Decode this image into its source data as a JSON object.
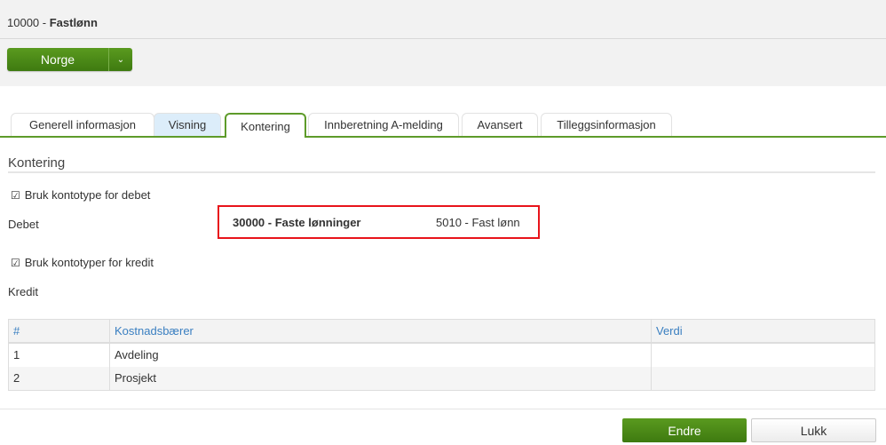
{
  "header": {
    "code": "10000",
    "separator": " - ",
    "name": "Fastlønn"
  },
  "country_button": {
    "label": "Norge",
    "dropdown_icon": "chevron-down-icon"
  },
  "tabs": [
    {
      "label": "Generell informasjon"
    },
    {
      "label": "Visning"
    },
    {
      "label": "Kontering"
    },
    {
      "label": "Innberetning A-melding"
    },
    {
      "label": "Avansert"
    },
    {
      "label": "Tilleggsinformasjon"
    }
  ],
  "section": {
    "title": "Kontering"
  },
  "debet": {
    "checkbox_label": "Bruk kontotype for debet",
    "label": "Debet",
    "account_type": "30000 - Faste lønninger",
    "account": "5010 - Fast lønn"
  },
  "kredit": {
    "checkbox_label": "Bruk kontotyper for kredit",
    "label": "Kredit"
  },
  "table": {
    "headers": [
      "#",
      "Kostnadsbærer",
      "Verdi"
    ],
    "rows": [
      [
        "1",
        "Avdeling",
        ""
      ],
      [
        "2",
        "Prosjekt",
        ""
      ]
    ]
  },
  "footer": {
    "edit_label": "Endre",
    "close_label": "Lukk"
  },
  "colors": {
    "accent": "#4a8a18",
    "highlight": "#e8141b",
    "link": "#3a7fc1"
  }
}
